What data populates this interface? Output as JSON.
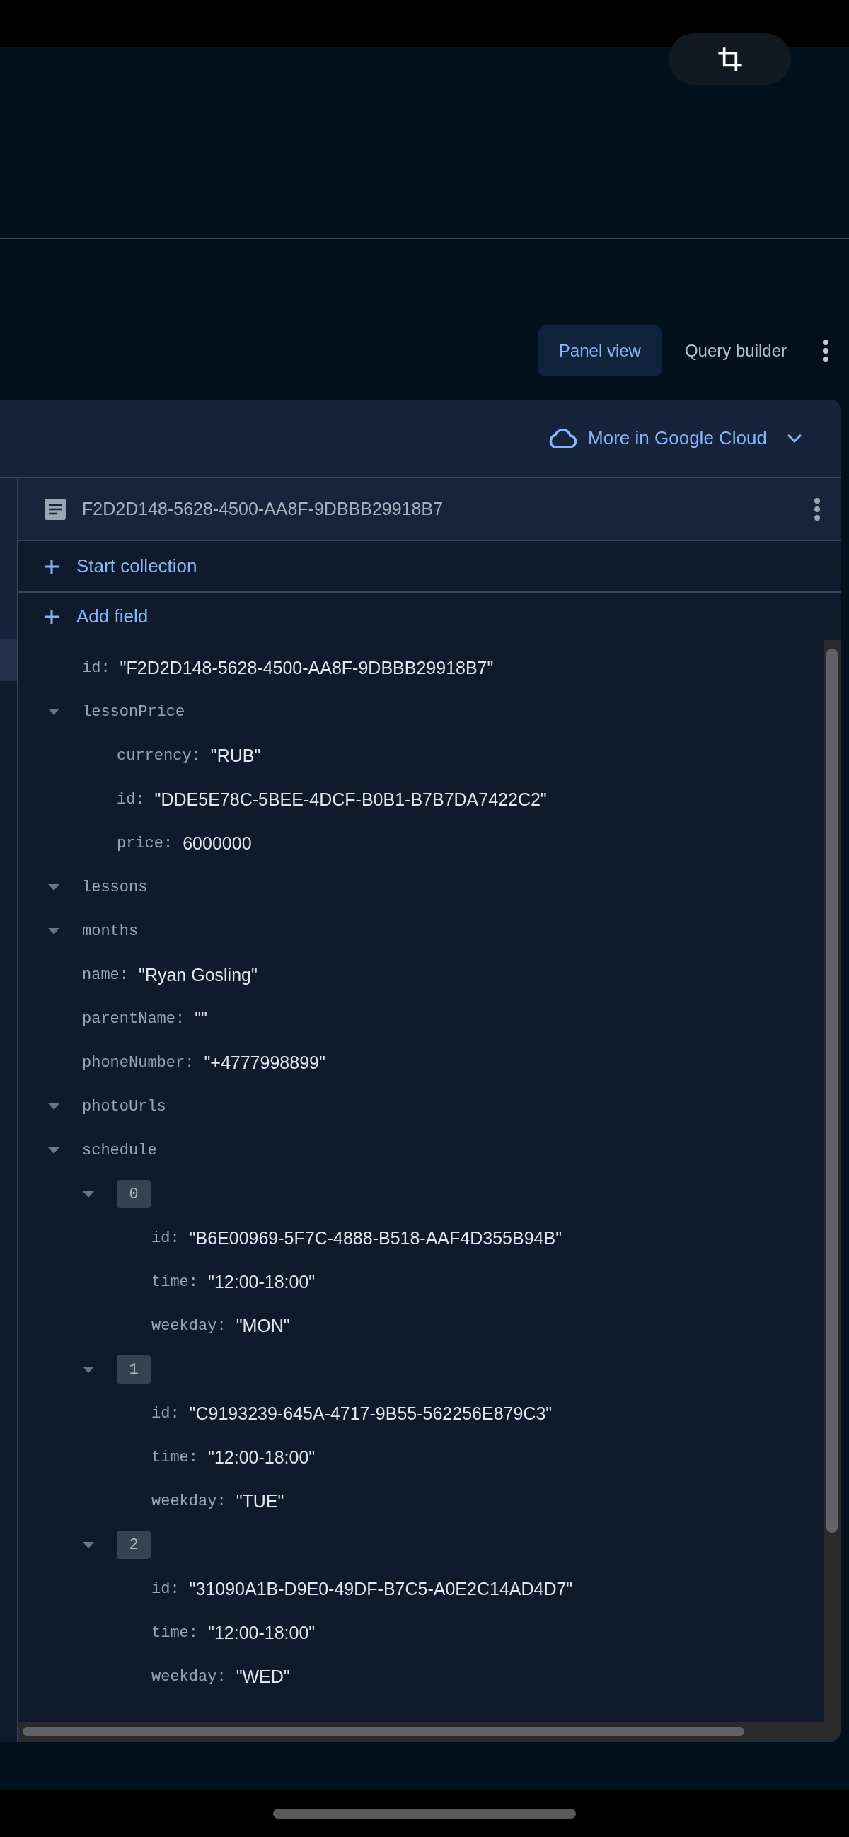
{
  "toolbar": {
    "tabs": [
      {
        "label": "Panel view",
        "selected": true
      },
      {
        "label": "Query builder",
        "selected": false
      }
    ]
  },
  "panel": {
    "cloud_link": "More in Google Cloud",
    "document": {
      "title": "F2D2D148-5628-4500-AA8F-9DBBB29918B7"
    },
    "actions": [
      "Start collection",
      "Add field"
    ],
    "fields": [
      {
        "kind": "value",
        "key": "id:",
        "value": "\"F2D2D148-5628-4500-AA8F-9DBBB29918B7\""
      },
      {
        "kind": "group",
        "key": "lessonPrice",
        "expanded": true,
        "children": [
          {
            "kind": "value",
            "key": "currency:",
            "value": "\"RUB\""
          },
          {
            "kind": "value",
            "key": "id:",
            "value": "\"DDE5E78C-5BEE-4DCF-B0B1-B7B7DA7422C2\""
          },
          {
            "kind": "value",
            "key": "price:",
            "value": "6000000"
          }
        ]
      },
      {
        "kind": "group",
        "key": "lessons",
        "expanded": true
      },
      {
        "kind": "group",
        "key": "months",
        "expanded": true
      },
      {
        "kind": "value",
        "key": "name:",
        "value": "\"Ryan Gosling\""
      },
      {
        "kind": "value",
        "key": "parentName:",
        "value": "\"\""
      },
      {
        "kind": "value",
        "key": "phoneNumber:",
        "value": "\"+4777998899\""
      },
      {
        "kind": "group",
        "key": "photoUrls",
        "expanded": true
      },
      {
        "kind": "group",
        "key": "schedule",
        "expanded": true,
        "children": [
          {
            "kind": "index",
            "key": "0",
            "expanded": true,
            "children": [
              {
                "kind": "value",
                "key": "id:",
                "value": "\"B6E00969-5F7C-4888-B518-AAF4D355B94B\""
              },
              {
                "kind": "value",
                "key": "time:",
                "value": "\"12:00-18:00\""
              },
              {
                "kind": "value",
                "key": "weekday:",
                "value": "\"MON\""
              }
            ]
          },
          {
            "kind": "index",
            "key": "1",
            "expanded": true,
            "children": [
              {
                "kind": "value",
                "key": "id:",
                "value": "\"C9193239-645A-4717-9B55-562256E879C3\""
              },
              {
                "kind": "value",
                "key": "time:",
                "value": "\"12:00-18:00\""
              },
              {
                "kind": "value",
                "key": "weekday:",
                "value": "\"TUE\""
              }
            ]
          },
          {
            "kind": "index",
            "key": "2",
            "expanded": true,
            "children": [
              {
                "kind": "value",
                "key": "id:",
                "value": "\"31090A1B-D9E0-49DF-B7C5-A0E2C14AD4D7\""
              },
              {
                "kind": "value",
                "key": "time:",
                "value": "\"12:00-18:00\""
              },
              {
                "kind": "value",
                "key": "weekday:",
                "value": "\"WED\""
              }
            ]
          }
        ]
      }
    ]
  }
}
